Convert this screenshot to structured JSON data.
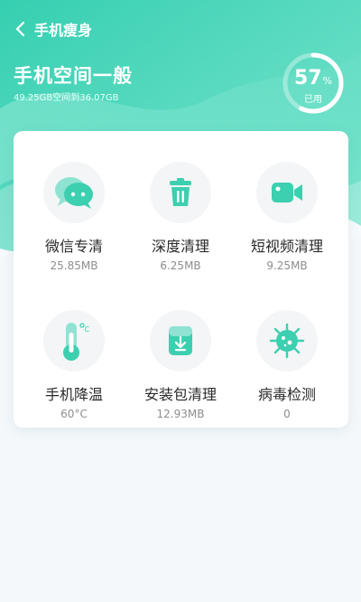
{
  "colors": {
    "accent": "#3ed3b4",
    "accent_dark": "#22b99a",
    "background": "#f4f8fb"
  },
  "header": {
    "back_icon": "chevron-left-icon",
    "title": "手机瘦身"
  },
  "storage": {
    "title": "手机空间一般",
    "summary": "49.25GB空间到36.07GB",
    "percent_used": "57",
    "percent_sign": "%",
    "percent_label": "已用"
  },
  "tools": [
    {
      "name": "微信专清",
      "value": "25.85MB",
      "icon": "wechat-icon"
    },
    {
      "name": "深度清理",
      "value": "6.25MB",
      "icon": "trash-icon"
    },
    {
      "name": "短视频清理",
      "value": "9.25MB",
      "icon": "video-camera-icon"
    },
    {
      "name": "手机降温",
      "value": "60°C",
      "icon": "thermometer-icon"
    },
    {
      "name": "安装包清理",
      "value": "12.93MB",
      "icon": "package-icon"
    },
    {
      "name": "病毒检测",
      "value": "0",
      "icon": "virus-icon"
    }
  ]
}
